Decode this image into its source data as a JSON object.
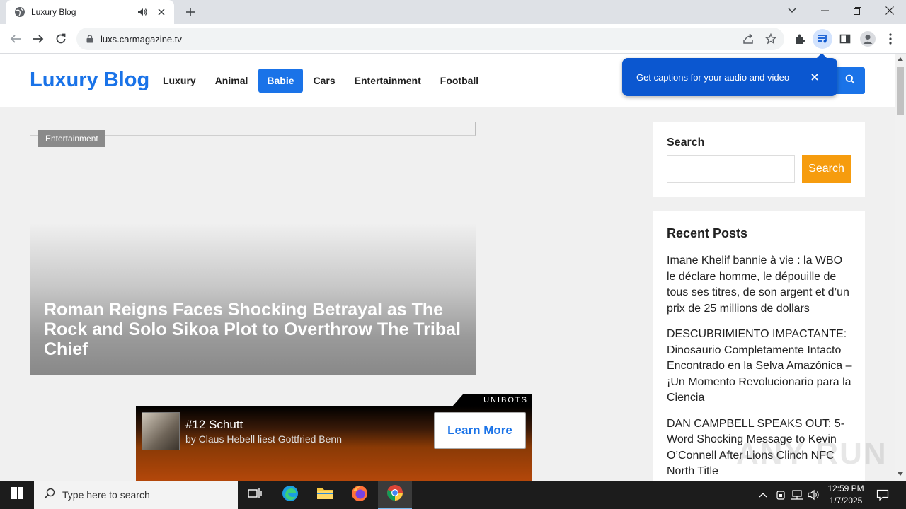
{
  "browser": {
    "tab_title": "Luxury Blog",
    "url": "luxs.carmagazine.tv"
  },
  "site": {
    "logo": "Luxury Blog",
    "nav": [
      {
        "label": "Luxury"
      },
      {
        "label": "Animal"
      },
      {
        "label": "Babie",
        "active": true
      },
      {
        "label": "Cars"
      },
      {
        "label": "Entertainment"
      },
      {
        "label": "Football"
      }
    ]
  },
  "caption_popup": {
    "text": "Get captions for your audio and video"
  },
  "hero": {
    "category": "Entertainment",
    "title": "Roman Reigns Faces Shocking Betrayal as The Rock and Solo Sikoa Plot to Overthrow The Tribal Chief"
  },
  "ad": {
    "brand": "UNIBOTS",
    "title": "#12 Schutt",
    "subtitle": "by Claus Hebell liest Gottfried Benn",
    "cta": "Learn More"
  },
  "sidebar": {
    "search_label": "Search",
    "search_button": "Search",
    "search_placeholder": "",
    "recent_heading": "Recent Posts",
    "posts": [
      "Imane Khelif bannie à vie : la WBO le déclare homme, le dépouille de tous ses titres, de son argent et d’un prix de 25 millions de dollars",
      "DESCUBRIMIENTO IMPACTANTE: Dinosaurio Completamente Intacto Encontrado en la Selva Amazónica – ¡Un Momento Revolucionario para la Ciencia",
      "DAN CAMPBELL SPEAKS OUT: 5-Word Shocking Message to Kevin O’Connell After Lions Clinch NFC North Title"
    ]
  },
  "watermark": "ANY RUN",
  "taskbar": {
    "search_placeholder": "Type here to search",
    "time": "12:59 PM",
    "date": "1/7/2025"
  },
  "colors": {
    "accent": "#1a73e8",
    "search_button": "#f69c0e",
    "popup": "#0b57d0"
  }
}
